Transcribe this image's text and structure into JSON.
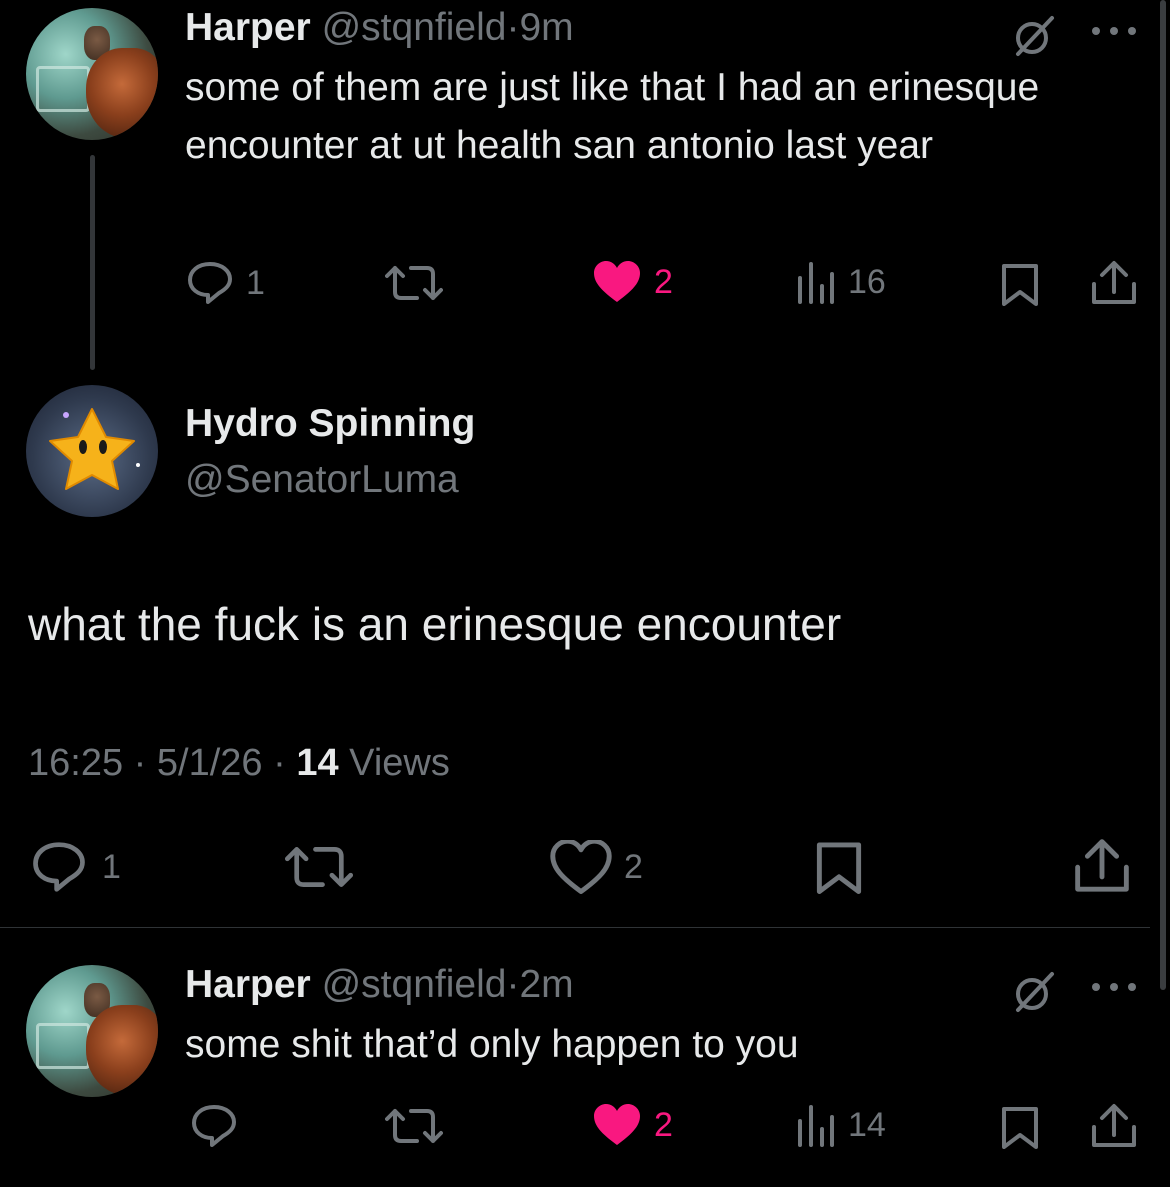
{
  "tweets": {
    "parent": {
      "name": "Harper",
      "handle": "@stqnfield",
      "sep": "·",
      "time": "9m",
      "text": "some of them are just like that I had an erinesque encounter at ut health san antonio last year",
      "replies": "1",
      "likes": "2",
      "views": "16"
    },
    "main": {
      "name": "Hydro Spinning",
      "handle": "@SenatorLuma",
      "text": "what the fuck is an erinesque encounter",
      "time": "16:25",
      "sep1": "·",
      "date": "5/1/26",
      "sep2": "·",
      "views_count": "14",
      "views_label": "Views",
      "replies": "1",
      "likes": "2"
    },
    "reply": {
      "name": "Harper",
      "handle": "@stqnfield",
      "sep": "·",
      "time": "2m",
      "text": "some shit that’d only happen to you",
      "likes": "2",
      "views": "14"
    }
  },
  "colors": {
    "background": "#000000",
    "text": "#e7e9ea",
    "muted": "#71767b",
    "like": "#f91880",
    "divider": "#2f3336"
  },
  "icons": [
    "reply-icon",
    "retweet-icon",
    "heart-icon",
    "views-icon",
    "bookmark-icon",
    "share-icon",
    "more-icon",
    "grok-icon"
  ]
}
